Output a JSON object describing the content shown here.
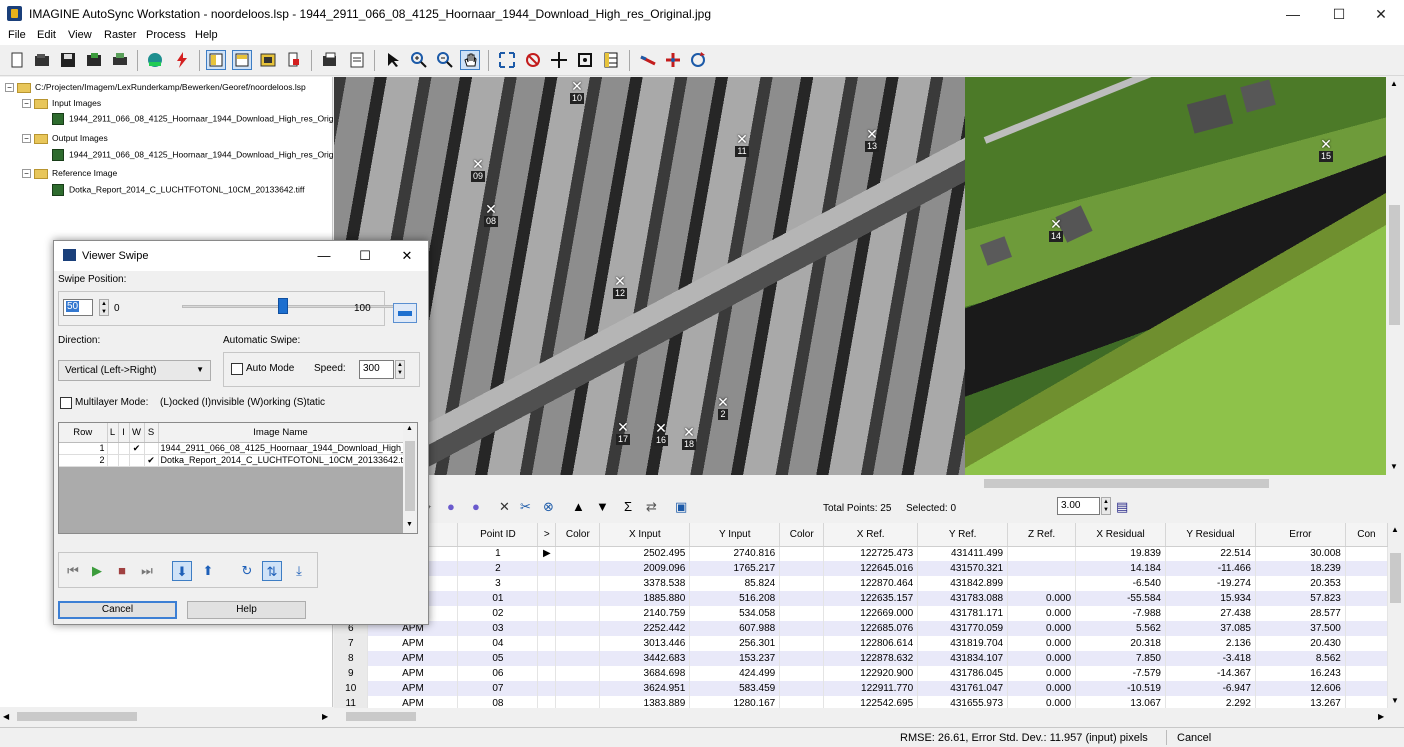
{
  "window": {
    "title": "IMAGINE AutoSync Workstation - noordeloos.lsp - 1944_2911_066_08_4125_Hoornaar_1944_Download_High_res_Original.jpg",
    "minimize": "—",
    "maximize": "☐",
    "close": "✕"
  },
  "menu": [
    "File",
    "Edit",
    "View",
    "Raster",
    "Process",
    "Help"
  ],
  "tree": {
    "root": "C:/Projecten/Imagem/LexRunderkamp/Bewerken/Georef/noordeloos.lsp",
    "input_folder": "Input Images",
    "input_file": "1944_2911_066_08_4125_Hoornaar_1944_Download_High_res_Original.jpg",
    "output_folder": "Output Images",
    "output_file": "1944_2911_066_08_4125_Hoornaar_1944_Download_High_res_Original.jpg",
    "reference_folder": "Reference Image",
    "reference_file": "Dotka_Report_2014_C_LUCHTFOTONL_10CM_20133642.tiff"
  },
  "viewer_left": {
    "points": [
      "10",
      "11",
      "13",
      "09",
      "08",
      "12",
      "2",
      "17",
      "16",
      "18"
    ]
  },
  "viewer_right": {
    "points": [
      "15",
      "14"
    ]
  },
  "gcp_toolbar": {
    "value": "3.00",
    "total_points": "Total Points: 25",
    "selected": "Selected: 0"
  },
  "gcp_table": {
    "columns": [
      "",
      "",
      "Point ID",
      ">",
      "Color",
      "X Input",
      "Y Input",
      "Color",
      "X Ref.",
      "Y Ref.",
      "Z Ref.",
      "X Residual",
      "Y Residual",
      "Error",
      "Con"
    ],
    "rows": [
      [
        "",
        "al",
        "1",
        "▶",
        "",
        "2502.495",
        "2740.816",
        "",
        "122725.473",
        "431411.499",
        "",
        "19.839",
        "22.514",
        "30.008",
        ""
      ],
      [
        "",
        "al",
        "2",
        "",
        "",
        "2009.096",
        "1765.217",
        "",
        "122645.016",
        "431570.321",
        "",
        "14.184",
        "-11.466",
        "18.239",
        ""
      ],
      [
        "",
        "al",
        "3",
        "",
        "",
        "3378.538",
        "85.824",
        "",
        "122870.464",
        "431842.899",
        "",
        "-6.540",
        "-19.274",
        "20.353",
        ""
      ],
      [
        "",
        "",
        "01",
        "",
        "",
        "1885.880",
        "516.208",
        "",
        "122635.157",
        "431783.088",
        "0.000",
        "-55.584",
        "15.934",
        "57.823",
        ""
      ],
      [
        "",
        "",
        "02",
        "",
        "",
        "2140.759",
        "534.058",
        "",
        "122669.000",
        "431781.171",
        "0.000",
        "-7.988",
        "27.438",
        "28.577",
        ""
      ],
      [
        "6",
        "APM",
        "03",
        "",
        "",
        "2252.442",
        "607.988",
        "",
        "122685.076",
        "431770.059",
        "0.000",
        "5.562",
        "37.085",
        "37.500",
        ""
      ],
      [
        "7",
        "APM",
        "04",
        "",
        "",
        "3013.446",
        "256.301",
        "",
        "122806.614",
        "431819.704",
        "0.000",
        "20.318",
        "2.136",
        "20.430",
        ""
      ],
      [
        "8",
        "APM",
        "05",
        "",
        "",
        "3442.683",
        "153.237",
        "",
        "122878.632",
        "431834.107",
        "0.000",
        "7.850",
        "-3.418",
        "8.562",
        ""
      ],
      [
        "9",
        "APM",
        "06",
        "",
        "",
        "3684.698",
        "424.499",
        "",
        "122920.900",
        "431786.045",
        "0.000",
        "-7.579",
        "-14.367",
        "16.243",
        ""
      ],
      [
        "10",
        "APM",
        "07",
        "",
        "",
        "3624.951",
        "583.459",
        "",
        "122911.770",
        "431761.047",
        "0.000",
        "-10.519",
        "-6.947",
        "12.606",
        ""
      ],
      [
        "11",
        "APM",
        "08",
        "",
        "",
        "1383.889",
        "1280.167",
        "",
        "122542.695",
        "431655.973",
        "0.000",
        "13.067",
        "2.292",
        "13.267",
        ""
      ]
    ]
  },
  "status": {
    "rmse": "RMSE: 26.61, Error Std. Dev.: 11.957 (input) pixels",
    "cancel": "Cancel"
  },
  "dialog": {
    "title": "Viewer Swipe",
    "swipe_position_label": "Swipe Position:",
    "swipe_value": "50",
    "swipe_min": "0",
    "swipe_max": "100",
    "swipe_fraction": 0.5,
    "direction_label": "Direction:",
    "direction_value": "Vertical (Left->Right)",
    "automatic_swipe_label": "Automatic Swipe:",
    "auto_mode_label": "Auto Mode",
    "speed_label": "Speed:",
    "speed_value": "300",
    "multilayer_label": "Multilayer Mode:",
    "multilayer_hint": "(L)ocked (I)nvisible (W)orking (S)tatic",
    "layer_columns": [
      "Row",
      "L",
      "I",
      "W",
      "S",
      "Image Name"
    ],
    "layers": [
      [
        "1",
        "",
        "",
        "✔",
        "",
        "1944_2911_066_08_4125_Hoornaar_1944_Download_High_res_Original.jpg"
      ],
      [
        "2",
        "",
        "",
        "",
        "✔",
        "Dotka_Report_2014_C_LUCHTFOTONL_10CM_20133642.tiff"
      ]
    ],
    "cancel_label": "Cancel",
    "help_label": "Help"
  },
  "colors": {
    "accent": "#3d7dc4",
    "row_alt": "#e9e9f9"
  }
}
